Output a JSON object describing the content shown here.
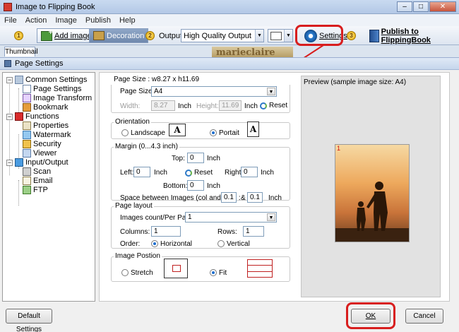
{
  "app": {
    "title": "Image to Flipping Book",
    "window_buttons": [
      "–",
      "□",
      "✕"
    ]
  },
  "menu": [
    "File",
    "Action",
    "Image",
    "Publish",
    "Help"
  ],
  "toolbar": {
    "step1_num": "1",
    "add_image_label": "Add image",
    "decoration_label": "Decoration",
    "step2_num": "2",
    "output_label": "Output:",
    "output_value": "High Quality Output",
    "settings_label": "Settings",
    "step3_num": "3",
    "publish_label": "Publish to FlippingBook"
  },
  "thumbnail_tab": "Thumbnail",
  "thumb_strip_text": "marieclaire",
  "dialog": {
    "title": "Page Settings",
    "tree": {
      "common": "Common Settings",
      "page_settings": "Page Settings",
      "image_transform": "Image Transform",
      "bookmark": "Bookmark",
      "functions": "Functions",
      "properties": "Properties",
      "watermark": "Watermark",
      "security": "Security",
      "viewer": "Viewer",
      "input_output": "Input/Output",
      "scan": "Scan",
      "email": "Email",
      "ftp": "FTP"
    },
    "page_size": {
      "title": "Page Size : w8.27 x h11.69",
      "size_label": "Page Size:",
      "size_value": "A4",
      "width_label": "Width:",
      "width_value": "8.27",
      "width_unit": "Inch",
      "height_label": "Height:",
      "height_value": "11.69",
      "height_unit": "Inch",
      "reset": "Reset"
    },
    "orientation": {
      "title": "Orientation",
      "landscape": "Landscape",
      "portrait": "Portait",
      "selected": "portrait"
    },
    "margin": {
      "title": "Margin (0...4.3 inch)",
      "top_label": "Top:",
      "top_value": "0",
      "left_label": "Left:",
      "left_value": "0",
      "right_label": "Right:",
      "right_value": "0",
      "bottom_label": "Bottom:",
      "bottom_value": "0",
      "unit": "Inch",
      "reset": "Reset",
      "spacing_label": "Space between Images (col and row) :",
      "spacing_col": "0.1",
      "spacing_amp": "&",
      "spacing_row": "0.1"
    },
    "page_layout": {
      "title": "Page layout",
      "count_label": "Images count/Per Page",
      "count_value": "1",
      "columns_label": "Columns:",
      "columns_value": "1",
      "rows_label": "Rows:",
      "rows_value": "1",
      "order_label": "Order:",
      "horizontal": "Horizontal",
      "vertical": "Vertical",
      "selected": "horizontal"
    },
    "image_position": {
      "title": "Image Postion",
      "stretch": "Stretch",
      "fit": "Fit",
      "selected": "fit"
    },
    "preview": {
      "title": "Preview (sample image size: A4)",
      "page_number": "1"
    },
    "buttons": {
      "default": "Default Settings",
      "ok": "OK",
      "cancel": "Cancel"
    }
  },
  "colors": {
    "highlight_ring": "#d81e1e",
    "titlebar": "#c9daf0"
  }
}
